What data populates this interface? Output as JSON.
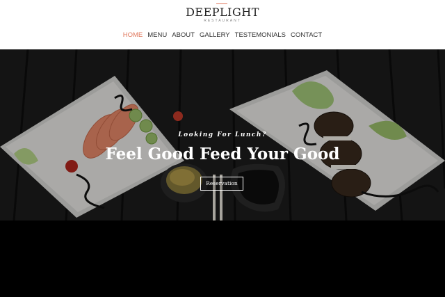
{
  "brand": {
    "name": "DEEPLIGHT",
    "subtitle": "RESTAURANT",
    "accent_color": "#e07a5f"
  },
  "nav": {
    "items": [
      {
        "label": "HOME",
        "active": true
      },
      {
        "label": "MENU",
        "active": false
      },
      {
        "label": "ABOUT",
        "active": false
      },
      {
        "label": "GALLERY",
        "active": false
      },
      {
        "label": "TESTEMONIALS",
        "active": false
      },
      {
        "label": "CONTACT",
        "active": false
      }
    ]
  },
  "hero": {
    "tagline": "Looking For Lunch?",
    "title": "Feel Good Feed Your Good",
    "button_label": "Reservation"
  }
}
